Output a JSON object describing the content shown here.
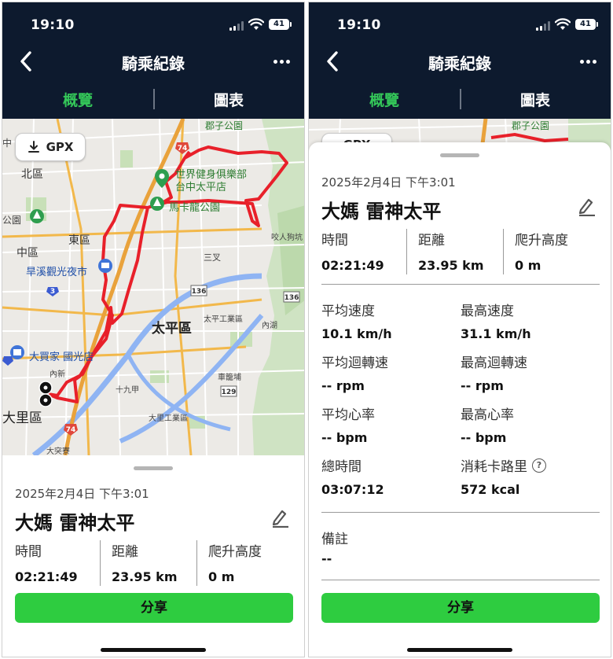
{
  "status": {
    "time": "19:10",
    "battery": "41"
  },
  "header": {
    "title": "騎乘紀錄"
  },
  "tabs": {
    "overview": "概覽",
    "charts": "圖表"
  },
  "map": {
    "gpx_label": "GPX",
    "labels": {
      "north_district": "北區",
      "east_district": "東區",
      "central_district": "中區",
      "taiping_district": "太平區",
      "dali_district": "大里區",
      "hanxi_market": "旱溪觀光夜市",
      "gym": "世界健身俱樂部",
      "gym_branch": "台中太平店",
      "makalong_park": "馬卡龍公園",
      "rt_mart": "大買家 國光店",
      "taiping_industrial": "太平工業區",
      "dali_industrial": "大里工業區",
      "sanchasa": "三叉",
      "neixin": "內新",
      "shijiujia": "十九甲",
      "cheji": "車籠埔",
      "neihu": "內湖",
      "yaoshengou": "咬人狗坑",
      "datuliao": "大突寮",
      "park_top": "郡子公園",
      "road_74": "74",
      "road_136": "136",
      "road_129": "129",
      "road_3": "3",
      "left_edge_1": "中",
      "left_edge_2": "公園"
    }
  },
  "ride": {
    "date": "2025年2月4日 下午3:01",
    "name": "大媽 雷神太平",
    "time_label": "時間",
    "time_value": "02:21:49",
    "distance_label": "距離",
    "distance_value": "23.95 km",
    "elevation_label": "爬升高度",
    "elevation_value": "0 m"
  },
  "details": {
    "avg_speed_label": "平均速度",
    "avg_speed_value": "10.1 km/h",
    "max_speed_label": "最高速度",
    "max_speed_value": "31.1 km/h",
    "avg_cadence_label": "平均迴轉速",
    "avg_cadence_value": "-- rpm",
    "max_cadence_label": "最高迴轉速",
    "max_cadence_value": "-- rpm",
    "avg_hr_label": "平均心率",
    "avg_hr_value": "-- bpm",
    "max_hr_label": "最高心率",
    "max_hr_value": "-- bpm",
    "total_time_label": "總時間",
    "total_time_value": "03:07:12",
    "calories_label": "消耗卡路里",
    "calories_value": "572 kcal",
    "info_glyph": "?",
    "notes_label": "備註",
    "notes_value": "--"
  },
  "actions": {
    "share_label": "分享"
  },
  "colors": {
    "navy": "#0d1a2e",
    "accent_green": "#34c759",
    "share_green": "#2ecc40",
    "route_red": "#e8202a"
  }
}
